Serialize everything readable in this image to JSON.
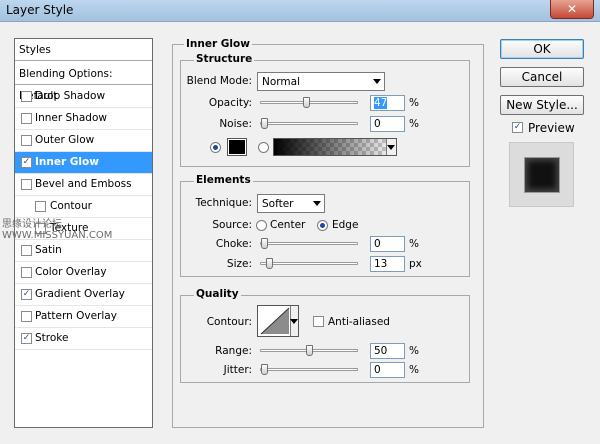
{
  "window": {
    "title": "Layer Style",
    "close_glyph": "✕"
  },
  "left_panel": {
    "header": "Styles",
    "blending": "Blending Options: Default",
    "items": [
      {
        "label": "Drop Shadow",
        "checked": false,
        "selected": false,
        "indent": false
      },
      {
        "label": "Inner Shadow",
        "checked": false,
        "selected": false,
        "indent": false
      },
      {
        "label": "Outer Glow",
        "checked": false,
        "selected": false,
        "indent": false
      },
      {
        "label": "Inner Glow",
        "checked": true,
        "selected": true,
        "indent": false
      },
      {
        "label": "Bevel and Emboss",
        "checked": false,
        "selected": false,
        "indent": false
      },
      {
        "label": "Contour",
        "checked": false,
        "selected": false,
        "indent": true
      },
      {
        "label": "Texture",
        "checked": false,
        "selected": false,
        "indent": true
      },
      {
        "label": "Satin",
        "checked": false,
        "selected": false,
        "indent": false
      },
      {
        "label": "Color Overlay",
        "checked": false,
        "selected": false,
        "indent": false
      },
      {
        "label": "Gradient Overlay",
        "checked": true,
        "selected": false,
        "indent": false
      },
      {
        "label": "Pattern Overlay",
        "checked": false,
        "selected": false,
        "indent": false
      },
      {
        "label": "Stroke",
        "checked": true,
        "selected": false,
        "indent": false
      }
    ]
  },
  "panel_title": "Inner Glow",
  "structure": {
    "title": "Structure",
    "blend_mode_label": "Blend Mode:",
    "blend_mode": "Normal",
    "opacity_label": "Opacity:",
    "opacity": "47",
    "opacity_unit": "%",
    "opacity_fraction": 0.47,
    "noise_label": "Noise:",
    "noise": "0",
    "noise_unit": "%",
    "noise_fraction": 0,
    "color_swatch": "#000000"
  },
  "elements": {
    "title": "Elements",
    "technique_label": "Technique:",
    "technique": "Softer",
    "source_label": "Source:",
    "source_center": "Center",
    "source_edge": "Edge",
    "choke_label": "Choke:",
    "choke": "0",
    "choke_unit": "%",
    "choke_fraction": 0,
    "size_label": "Size:",
    "size": "13",
    "size_unit": "px",
    "size_fraction": 0.052
  },
  "quality": {
    "title": "Quality",
    "contour_label": "Contour:",
    "anti_aliased": "Anti-aliased",
    "range_label": "Range:",
    "range": "50",
    "range_unit": "%",
    "range_fraction": 0.5,
    "jitter_label": "Jitter:",
    "jitter": "0",
    "jitter_unit": "%",
    "jitter_fraction": 0
  },
  "buttons": {
    "ok": "OK",
    "cancel": "Cancel",
    "new_style": "New Style...",
    "preview": "Preview",
    "preview_checked": true
  },
  "watermark": "思缘设计论坛 WWW.MISSYUAN.COM"
}
